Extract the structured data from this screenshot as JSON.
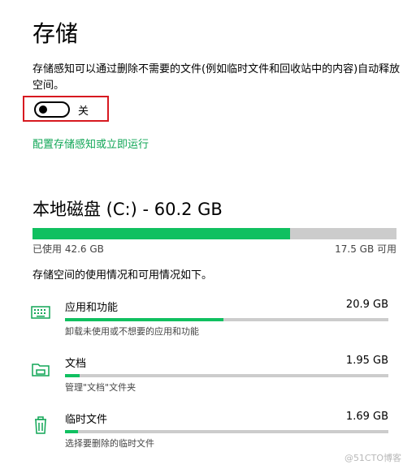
{
  "page": {
    "title": "存储",
    "description": "存储感知可以通过删除不需要的文件(例如临时文件和回收站中的内容)自动释放空间。"
  },
  "storage_sense": {
    "toggle_state": "off",
    "toggle_label": "关",
    "configure_link": "配置存储感知或立即运行"
  },
  "disk": {
    "title": "本地磁盘 (C:) - 60.2 GB",
    "used_label": "已使用 42.6 GB",
    "free_label": "17.5 GB 可用",
    "used_fraction": 0.708,
    "usage_caption": "存储空间的使用情况和可用情况如下。"
  },
  "categories": [
    {
      "icon": "keyboard-icon",
      "name": "应用和功能",
      "size": "20.9 GB",
      "subtitle": "卸载未使用或不想要的应用和功能",
      "fraction": 0.49
    },
    {
      "icon": "folder-icon",
      "name": "文档",
      "size": "1.95 GB",
      "subtitle": "管理\"文档\"文件夹",
      "fraction": 0.046
    },
    {
      "icon": "trash-icon",
      "name": "临时文件",
      "size": "1.69 GB",
      "subtitle": "选择要删除的临时文件",
      "fraction": 0.04
    }
  ],
  "watermark": "@51CTO博客",
  "colors": {
    "accent_green": "#10c060",
    "link_green": "#10a656",
    "highlight_red": "#d71920",
    "bar_gray": "#cccccc"
  }
}
